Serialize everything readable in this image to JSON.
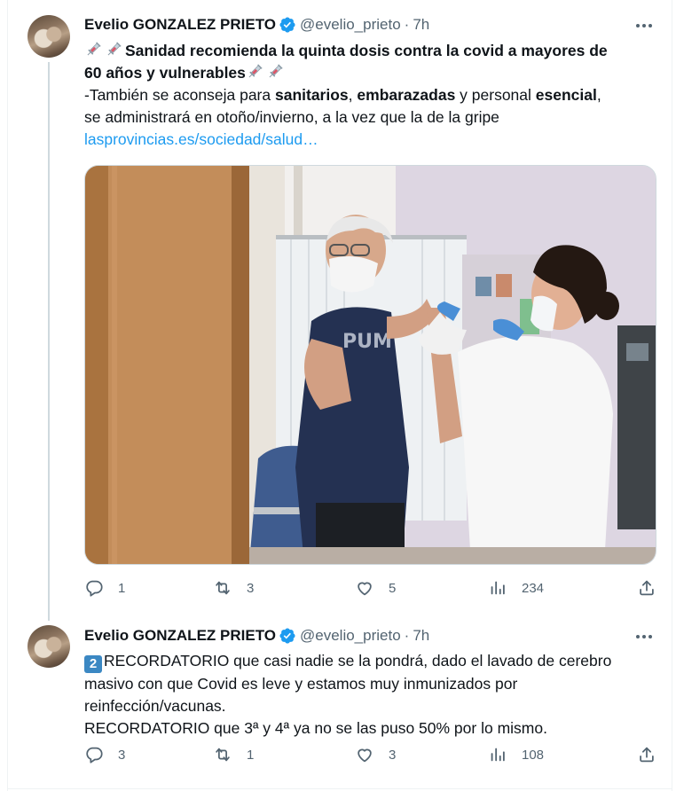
{
  "colors": {
    "link": "#1d9bf0",
    "verified": "#1d9bf0",
    "secondary_text": "#536471",
    "primary_text": "#0f1419",
    "thread_line": "#cfd9de"
  },
  "tweets": [
    {
      "author_name": "Evelio GONZALEZ PRIETO",
      "handle": "@evelio_prieto",
      "separator": "·",
      "time": "7h",
      "emoji_lead": "syringe-icon x2",
      "headline_line1": "Sanidad recomienda la quinta dosis contra la covid a mayores de",
      "headline_line2": "60 años y vulnerables",
      "text_l3_a": "-También se aconseja para ",
      "text_l3_b": "sanitarios",
      "text_l3_c": ", ",
      "text_l3_d": "embarazadas",
      "text_l3_e": " y personal ",
      "text_l3_f": "esencial",
      "text_l3_g": ",",
      "text_l4": "se administrará en otoño/invierno, a la vez que la de la gripe",
      "link": "lasprovincias.es/sociedad/salud…",
      "image_description_icon": "vaccination-photo",
      "actions": {
        "replies": "1",
        "retweets": "3",
        "likes": "5",
        "views": "234"
      }
    },
    {
      "author_name": "Evelio GONZALEZ PRIETO",
      "handle": "@evelio_prieto",
      "separator": "·",
      "time": "7h",
      "keycap": "2",
      "line1": "RECORDATORIO que casi nadie se la pondrá, dado el lavado de cerebro",
      "line2": "masivo con que Covid es leve y estamos muy inmunizados por",
      "line3": "reinfección/vacunas.",
      "line4": "RECORDATORIO que 3ª y 4ª ya no se las puso 50% por lo mismo.",
      "actions": {
        "replies": "3",
        "retweets": "1",
        "likes": "3",
        "views": "108"
      }
    }
  ]
}
